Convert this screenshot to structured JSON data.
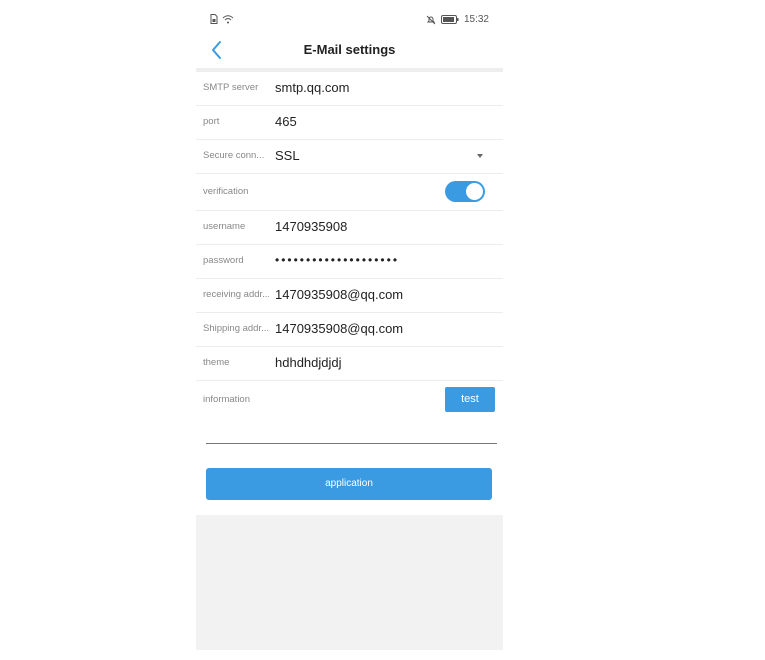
{
  "statusbar": {
    "time": "15:32"
  },
  "navbar": {
    "title": "E-Mail settings"
  },
  "form": {
    "smtp_server": {
      "label": "SMTP server",
      "value": "smtp.qq.com"
    },
    "port": {
      "label": "port",
      "value": "465"
    },
    "secure_connection": {
      "label": "Secure conn...",
      "value": "SSL"
    },
    "verification": {
      "label": "verification",
      "enabled": true
    },
    "username": {
      "label": "username",
      "value": "1470935908"
    },
    "password": {
      "label": "password",
      "value": "••••••••••••••••••••"
    },
    "receiving_address": {
      "label": "receiving addr...",
      "value": "1470935908@qq.com"
    },
    "shipping_address": {
      "label": "Shipping addr...",
      "value": "1470935908@qq.com"
    },
    "theme": {
      "label": "theme",
      "value": "hdhdhdjdjdj"
    },
    "information": {
      "label": "information",
      "test_label": "test",
      "value": ""
    }
  },
  "apply_label": "application",
  "colors": {
    "accent": "#3b9be2",
    "background": "#ffffff",
    "bottom_area": "#f2f2f2"
  }
}
